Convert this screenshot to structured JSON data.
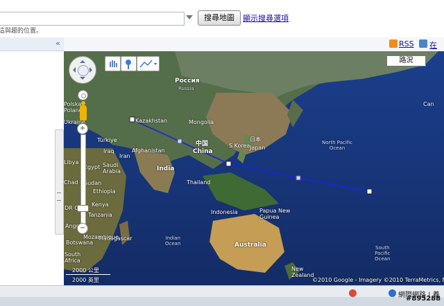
{
  "search": {
    "button_label": "搜尋地圖",
    "options_link": "顯示搜尋選項",
    "hint": "這與趨的位置。"
  },
  "map_links": {
    "rss": "RSS",
    "edit": "在"
  },
  "map": {
    "traffic_button": "路況",
    "copyright": "©2010 Google - Imagery ©2010 TerraMetrics, N",
    "scale": {
      "metric": "2000 公里",
      "imperial": "2000 英里"
    },
    "labels": {
      "russia": "Россия",
      "russia_en": "Russia",
      "kazakhstan": "Kazakhstan",
      "mongolia": "Mongolia",
      "china_cn": "中国",
      "china": "China",
      "korea": "S Korea",
      "japan_cn": "日本",
      "japan": "Japan",
      "north_pacific": "North Pacific\nOcean",
      "india": "India",
      "afghanistan": "Afghanistan",
      "iraq": "Iraq",
      "iran": "Iran",
      "saudi": "Saudi\nArabia",
      "thailand": "Thailand",
      "indonesia": "Indonesia",
      "png": "Papua New\nGuinea",
      "australia": "Australia",
      "indian_ocean": "Indian\nOcean",
      "south_pacific": "South\nPacific\nOcean",
      "new_zealand": "New\nZealand",
      "madagascar": "Madagascar",
      "kenya": "Kenya",
      "tanzania": "Tanzania",
      "ethiopia": "Ethiopia",
      "libya": "Libya",
      "chad": "Chad",
      "sudan": "Sudan",
      "egypt": "Egypt",
      "turkey": "Türkiye",
      "poland": "Polska\nPoland",
      "ukraine": "Ukraine",
      "botswana": "Botswana",
      "south_africa": "South\nAfrica",
      "dr_congo": "DR Con",
      "angola": "Angola",
      "mozambique": "Mozambique",
      "canada": "Can"
    }
  },
  "status_bar": {
    "network": "網際網路 | 養",
    "watermark": "#895288"
  }
}
